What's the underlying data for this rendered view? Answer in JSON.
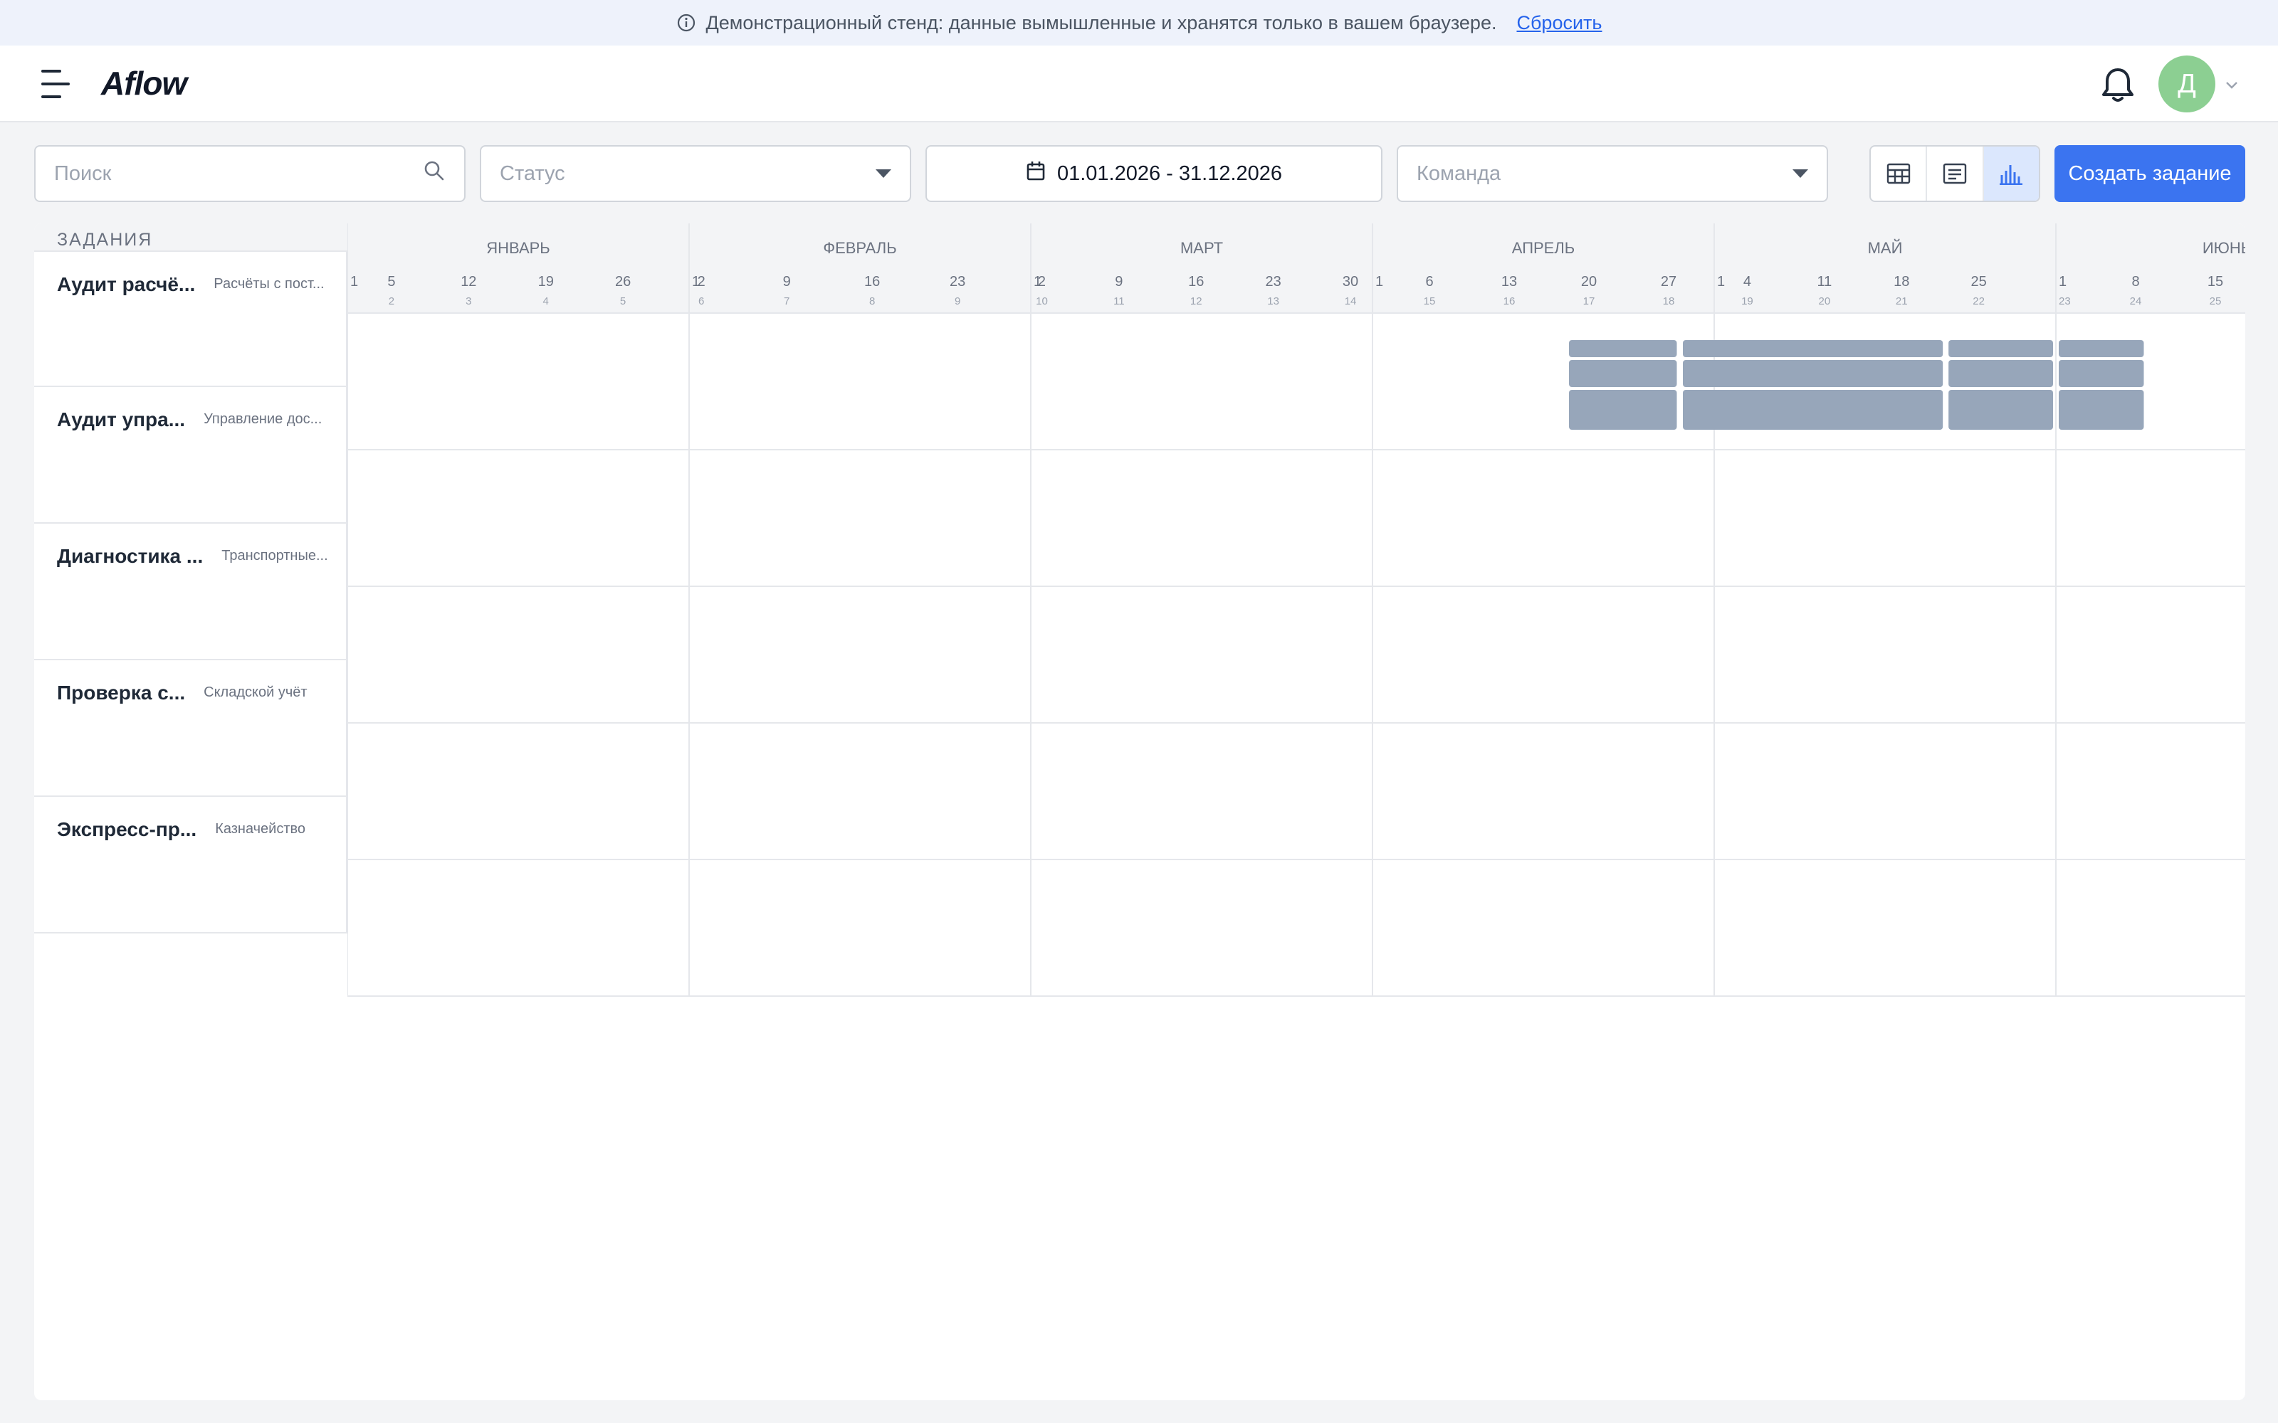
{
  "banner": {
    "message": "Демонстрационный стенд: данные вымышленные и хранятся только в вашем браузере.",
    "reset_label": "Сбросить",
    "icon": "info-icon"
  },
  "header": {
    "logo": "Aflow",
    "avatar_letter": "Д",
    "avatar_color": "#8ccf92",
    "menu_icon": "burger-menu-icon",
    "bell_icon": "bell-icon"
  },
  "filters": {
    "search_placeholder": "Поиск",
    "status_placeholder": "Статус",
    "date_range": "01.01.2026 - 31.12.2026",
    "team_placeholder": "Команда"
  },
  "toolbar": {
    "views": [
      "table-view-icon",
      "list-view-icon",
      "gantt-view-icon"
    ],
    "active_view": "gantt-view-icon",
    "create_label": "Создать задание",
    "accent": "#3b74f0"
  },
  "tasks_header": "ЗАДАНИЯ",
  "tasks": [
    {
      "title": "Аудит расчё...",
      "subtitle": "Расчёты с пост..."
    },
    {
      "title": "Аудит упра...",
      "subtitle": "Управление дос..."
    },
    {
      "title": "Диагностика ...",
      "subtitle": "Транспортные..."
    },
    {
      "title": "Проверка с...",
      "subtitle": "Складской учёт"
    },
    {
      "title": "Экспресс-пр...",
      "subtitle": "Казначейство"
    }
  ],
  "timeline": {
    "months": [
      {
        "name": "ЯНВАРЬ",
        "ticks": [
          {
            "day": "1",
            "week": ""
          },
          {
            "day": "5",
            "week": "2"
          },
          {
            "day": "12",
            "week": "3"
          },
          {
            "day": "19",
            "week": "4"
          },
          {
            "day": "26",
            "week": "5"
          }
        ]
      },
      {
        "name": "ФЕВРАЛЬ",
        "ticks": [
          {
            "day": "1",
            "week": ""
          },
          {
            "day": "2",
            "week": "6"
          },
          {
            "day": "9",
            "week": "7"
          },
          {
            "day": "16",
            "week": "8"
          },
          {
            "day": "23",
            "week": "9"
          }
        ]
      },
      {
        "name": "МАРТ",
        "ticks": [
          {
            "day": "1",
            "week": ""
          },
          {
            "day": "2",
            "week": "10"
          },
          {
            "day": "9",
            "week": "11"
          },
          {
            "day": "16",
            "week": "12"
          },
          {
            "day": "23",
            "week": "13"
          },
          {
            "day": "30",
            "week": "14"
          }
        ]
      },
      {
        "name": "АПРЕЛЬ",
        "ticks": [
          {
            "day": "1",
            "week": ""
          },
          {
            "day": "6",
            "week": "15"
          },
          {
            "day": "13",
            "week": "16"
          },
          {
            "day": "20",
            "week": "17"
          },
          {
            "day": "27",
            "week": "18"
          }
        ]
      },
      {
        "name": "МАЙ",
        "ticks": [
          {
            "day": "1",
            "week": ""
          },
          {
            "day": "4",
            "week": "19"
          },
          {
            "day": "11",
            "week": "20"
          },
          {
            "day": "18",
            "week": "21"
          },
          {
            "day": "25",
            "week": "22"
          }
        ]
      },
      {
        "name": "ИЮНЬ",
        "ticks": [
          {
            "day": "1",
            "week": "23"
          },
          {
            "day": "8",
            "week": "24"
          },
          {
            "day": "15",
            "week": "25"
          }
        ]
      }
    ],
    "bar_color": "#97a6ba",
    "bars": [
      {
        "start": "2026-04-18",
        "end": "2026-04-27",
        "row": 0,
        "subrows": 3
      },
      {
        "start": "2026-04-28",
        "end": "2026-05-21",
        "row": 0,
        "subrows": 3
      },
      {
        "start": "2026-05-22",
        "end": "2026-05-31",
        "row": 0,
        "subrows": 3
      },
      {
        "start": "2026-06-01",
        "end": "2026-06-08",
        "row": 0,
        "subrows": 3
      }
    ]
  }
}
